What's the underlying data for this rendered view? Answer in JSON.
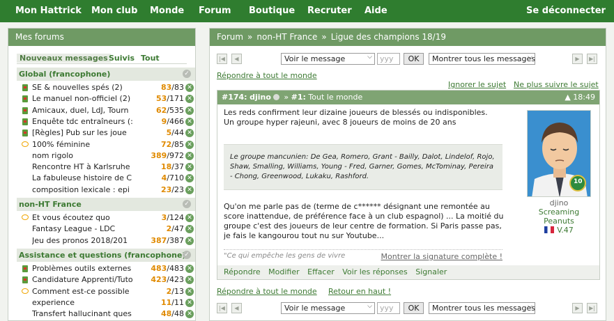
{
  "nav": {
    "items": [
      "Mon Hattrick",
      "Mon club",
      "Monde",
      "Forum",
      "Boutique",
      "Recruter",
      "Aide"
    ],
    "logout": "Se déconnecter"
  },
  "sidebar": {
    "title": "Mes forums",
    "tabs": [
      "Nouveaux messages",
      "Suivis",
      "Tout"
    ],
    "sections": [
      {
        "title": "Global (francophone)",
        "rows": [
          {
            "title": "SE & nouvelles spés (2)",
            "new": "83",
            "total": "/83",
            "icon": "flag"
          },
          {
            "title": "Le manuel non-officiel (2)",
            "new": "53",
            "total": "/171",
            "icon": "flag"
          },
          {
            "title": "Amicaux, duel, LdJ, Tourn",
            "new": "62",
            "total": "/535",
            "icon": "flag"
          },
          {
            "title": "Enquête tdc entraîneurs (:",
            "new": "9",
            "total": "/466",
            "icon": "flag"
          },
          {
            "title": "[Règles] Pub sur les joue",
            "new": "5",
            "total": "/44",
            "icon": "flag"
          },
          {
            "title": "100% féminine",
            "new": "72",
            "total": "/85",
            "icon": "bubble"
          },
          {
            "title": "nom rigolo",
            "new": "389",
            "total": "/972",
            "icon": "none"
          },
          {
            "title": "Rencontre HT à Karlsruhe",
            "new": "18",
            "total": "/37",
            "icon": "none"
          },
          {
            "title": "La fabuleuse histoire de C",
            "new": "4",
            "total": "/710",
            "icon": "none"
          },
          {
            "title": "composition lexicale : epi",
            "new": "23",
            "total": "/23",
            "icon": "none"
          }
        ]
      },
      {
        "title": "non-HT France",
        "rows": [
          {
            "title": "Et vous écoutez quo",
            "new": "3",
            "total": "/124",
            "icon": "bubble"
          },
          {
            "title": "Fantasy League - LDC",
            "new": "2",
            "total": "/47",
            "icon": "none"
          },
          {
            "title": "Jeu des pronos 2018/201",
            "new": "387",
            "total": "/387",
            "icon": "none"
          }
        ]
      },
      {
        "title": "Assistance et questions (francophone)",
        "rows": [
          {
            "title": "Problèmes outils externes",
            "new": "483",
            "total": "/483",
            "icon": "flag"
          },
          {
            "title": "Candidature Apprenti/Tuto",
            "new": "423",
            "total": "/423",
            "icon": "flag"
          },
          {
            "title": "Comment est-ce possible",
            "new": "2",
            "total": "/13",
            "icon": "bubble"
          },
          {
            "title": "experience",
            "new": "11",
            "total": "/11",
            "icon": "none"
          },
          {
            "title": "Transfert hallucinant ques",
            "new": "48",
            "total": "/48",
            "icon": "none"
          }
        ]
      }
    ]
  },
  "main": {
    "breadcrumb": [
      "Forum",
      "non-HT France",
      "Ligue des champions 18/19"
    ],
    "pager": {
      "select_label": "Voir le message",
      "num_placeholder": "yyy",
      "ok_label": "OK",
      "filter_label": "Montrer tous les messages"
    },
    "reply_all": "Répondre à tout le monde",
    "ignore_topic": "Ignorer le sujet",
    "unfollow_topic": "Ne plus suivre le sujet",
    "back_to_top": "Retour en haut !",
    "post": {
      "number": "#174:",
      "author": "djino",
      "reply_to": "#1:",
      "recipient": "Tout le monde",
      "time": "18:49",
      "line1": "Les reds confirment leur dizaine joueurs de blessés ou indisponibles.",
      "line2": "Un groupe hyper rajeuni, avec 8 joueurs de moins de 20 ans",
      "quote": "Le groupe mancunien: De Gea, Romero, Grant - Bailly, Dalot, Lindelof, Rojo, Shaw, Smalling, Williams, Young - Fred, Garner, Gomes, McTominay, Pereira - Chong, Greenwood, Lukaku, Rashford.",
      "para": "Qu'on me parle pas de (terme de c****** désignant une remontée au score inattendue, de préférence face à un club espagnol) ... La moitié du groupe c'est des joueurs de leur centre de formation. Si Paris passe pas, je fais le kangourou tout nu sur Youtube...",
      "signature": "\"Ce qui empêche les gens de vivre",
      "show_signature": "Montrer la signature complète !",
      "actions": [
        "Répondre",
        "Modifier",
        "Effacer",
        "Voir les réponses",
        "Signaler"
      ],
      "author_team_line1": "Screaming",
      "author_team_line2": "Peanuts",
      "author_version": "V.47",
      "badge": "10"
    }
  }
}
